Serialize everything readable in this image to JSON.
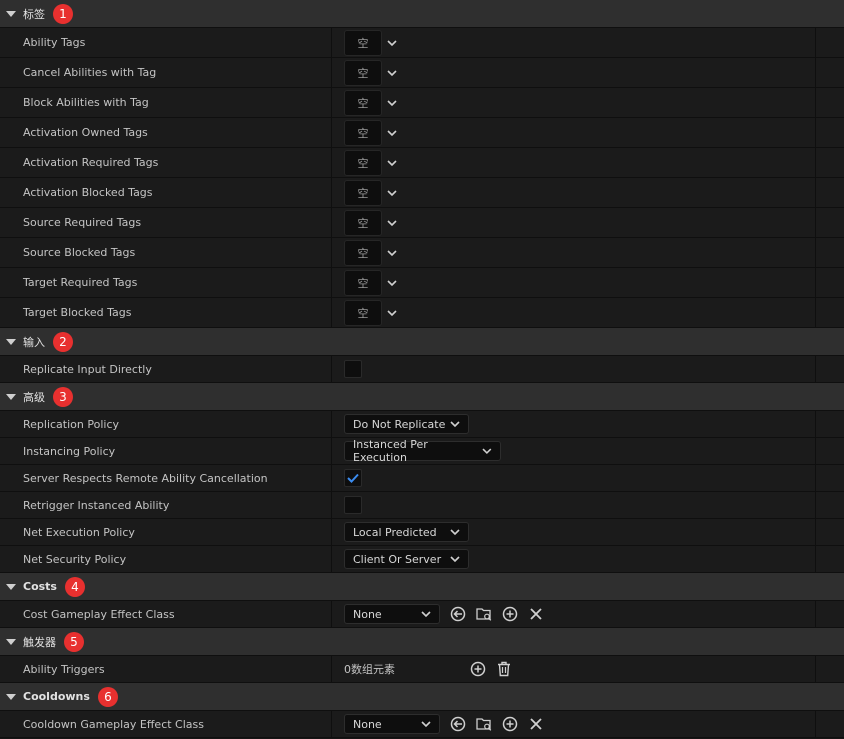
{
  "sections": {
    "tags": {
      "title": "标签",
      "badge": "1",
      "rows": [
        {
          "label": "Ability Tags",
          "value": "空"
        },
        {
          "label": "Cancel Abilities with Tag",
          "value": "空"
        },
        {
          "label": "Block Abilities with Tag",
          "value": "空"
        },
        {
          "label": "Activation Owned Tags",
          "value": "空"
        },
        {
          "label": "Activation Required Tags",
          "value": "空"
        },
        {
          "label": "Activation Blocked Tags",
          "value": "空"
        },
        {
          "label": "Source Required Tags",
          "value": "空"
        },
        {
          "label": "Source Blocked Tags",
          "value": "空"
        },
        {
          "label": "Target Required Tags",
          "value": "空"
        },
        {
          "label": "Target Blocked Tags",
          "value": "空"
        }
      ]
    },
    "input": {
      "title": "输入",
      "badge": "2",
      "replicate_label": "Replicate Input Directly",
      "replicate_checked": false
    },
    "advanced": {
      "title": "高级",
      "badge": "3",
      "replication_policy_label": "Replication Policy",
      "replication_policy_value": "Do Not Replicate",
      "instancing_policy_label": "Instancing Policy",
      "instancing_policy_value": "Instanced Per Execution",
      "server_cancel_label": "Server Respects Remote Ability Cancellation",
      "server_cancel_checked": true,
      "retrigger_label": "Retrigger Instanced Ability",
      "retrigger_checked": false,
      "net_exec_label": "Net Execution Policy",
      "net_exec_value": "Local Predicted",
      "net_security_label": "Net Security Policy",
      "net_security_value": "Client Or Server"
    },
    "costs": {
      "title": "Costs",
      "badge": "4",
      "cost_label": "Cost Gameplay Effect Class",
      "cost_value": "None"
    },
    "triggers": {
      "title": "触发器",
      "badge": "5",
      "triggers_label": "Ability Triggers",
      "triggers_value": "0数组元素"
    },
    "cooldowns": {
      "title": "Cooldowns",
      "badge": "6",
      "cooldown_label": "Cooldown Gameplay Effect Class",
      "cooldown_value": "None"
    }
  },
  "colors": {
    "badge": "#e8302f",
    "checkmark": "#3b8cf0",
    "header_bg": "#2f2f2f",
    "row_bg": "#1b1b1b"
  },
  "icons": [
    "chevron-down-icon",
    "checkmark-icon",
    "browse-back-icon",
    "browse-folder-icon",
    "add-icon",
    "clear-icon",
    "delete-icon"
  ]
}
